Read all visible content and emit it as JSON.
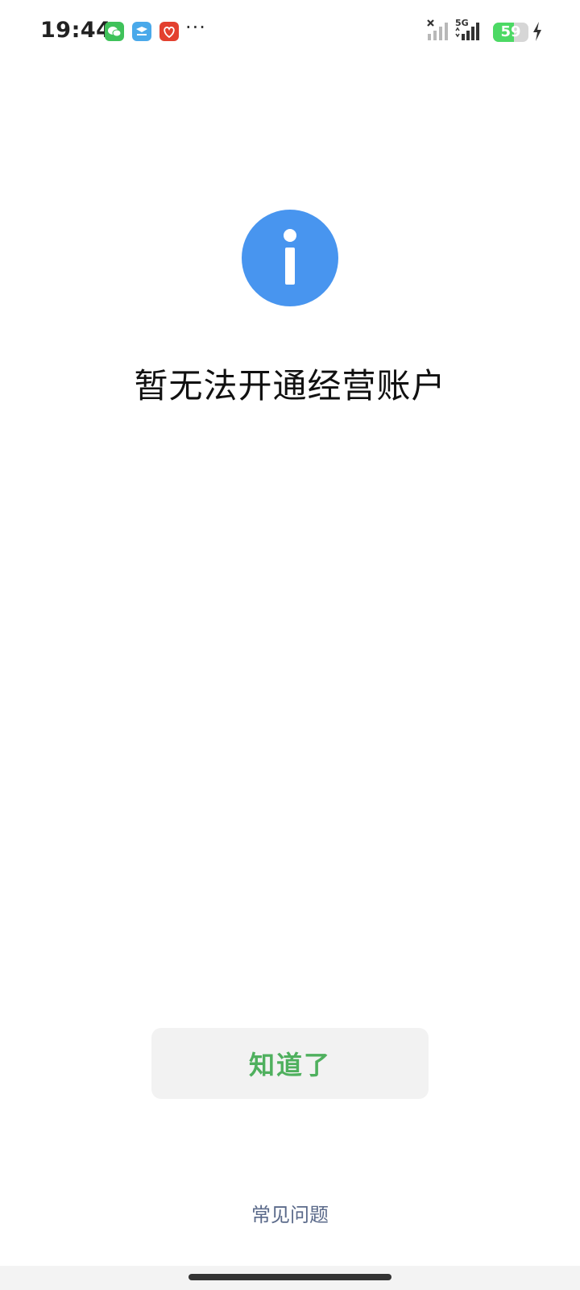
{
  "status_bar": {
    "time": "19:44",
    "more_indicator": "···",
    "network_label": "5G",
    "battery_level": "59",
    "battery_fraction": 0.59,
    "icons": [
      "wechat-icon",
      "sky-app-icon",
      "red-app-icon",
      "no-signal-icon",
      "signal-icon",
      "battery-icon",
      "charging-icon"
    ],
    "colors": {
      "wechat": "#3fc25a",
      "sky_app": "#4aa9ea",
      "red_app": "#e3402f",
      "battery_fill": "#4cd964"
    }
  },
  "main": {
    "icon": "info-icon",
    "icon_color": "#4895ef",
    "title": "暂无法开通经营账户"
  },
  "actions": {
    "ok_button_label": "知道了",
    "ok_button_color": "#4fb05e",
    "faq_link_label": "常见问题",
    "faq_link_color": "#5b6a8a"
  }
}
